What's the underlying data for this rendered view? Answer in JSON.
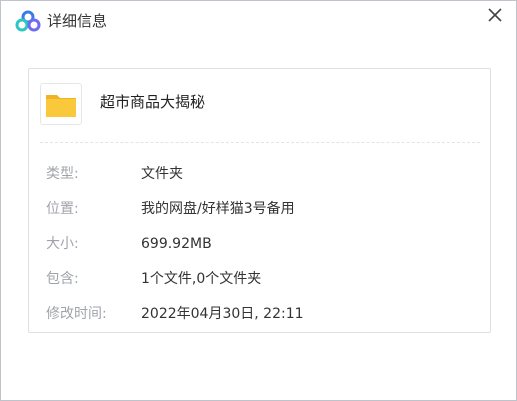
{
  "window": {
    "title": "详细信息",
    "close_icon": "close-icon",
    "logo_icon": "cloud-logo-icon",
    "colors": {
      "logo_blue": "#3a7be8",
      "logo_teal": "#2cc7c2",
      "logo_purple": "#6f6bf0",
      "folder_yellow": "#f9c83b"
    }
  },
  "file": {
    "icon": "folder-icon",
    "name": "超市商品大揭秘"
  },
  "details": [
    {
      "label": "类型:",
      "value": "文件夹"
    },
    {
      "label": "位置:",
      "value": "我的网盘/好样猫3号备用"
    },
    {
      "label": "大小:",
      "value": "699.92MB"
    },
    {
      "label": "包含:",
      "value": "1个文件,0个文件夹"
    },
    {
      "label": "修改时间:",
      "value": "2022年04月30日, 22:11"
    }
  ]
}
